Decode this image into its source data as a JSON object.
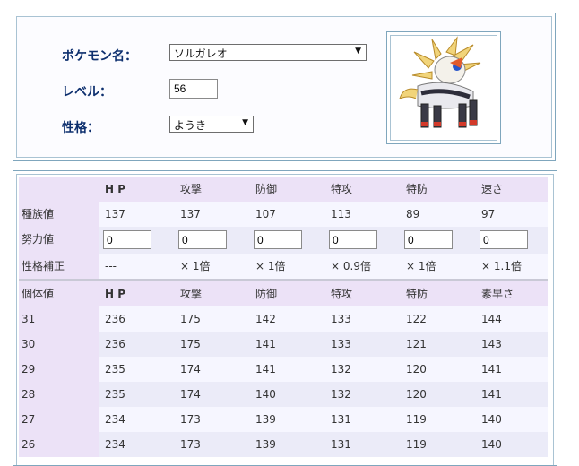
{
  "form": {
    "pokemon_label": "ポケモン名：",
    "pokemon_value": "ソルガレオ",
    "level_label": "レベル：",
    "level_value": "56",
    "nature_label": "性格：",
    "nature_value": "ようき"
  },
  "stats_table": {
    "headers": [
      "",
      "H P",
      "攻撃",
      "防御",
      "特攻",
      "特防",
      "速さ"
    ],
    "base": {
      "label": "種族値",
      "values": [
        "137",
        "137",
        "107",
        "113",
        "89",
        "97"
      ]
    },
    "ev": {
      "label": "努力値",
      "values": [
        "0",
        "0",
        "0",
        "0",
        "0",
        "0"
      ]
    },
    "nature_mod": {
      "label": "性格補正",
      "values": [
        "---",
        "× 1倍",
        "× 1倍",
        "× 0.9倍",
        "× 1倍",
        "× 1.1倍"
      ]
    }
  },
  "iv_table": {
    "headers": [
      "個体値",
      "H P",
      "攻撃",
      "防御",
      "特攻",
      "特防",
      "素早さ"
    ],
    "rows": [
      [
        "31",
        "236",
        "175",
        "142",
        "133",
        "122",
        "144"
      ],
      [
        "30",
        "236",
        "175",
        "141",
        "133",
        "121",
        "143"
      ],
      [
        "29",
        "235",
        "174",
        "141",
        "132",
        "120",
        "141"
      ],
      [
        "28",
        "235",
        "174",
        "140",
        "132",
        "120",
        "141"
      ],
      [
        "27",
        "234",
        "173",
        "139",
        "131",
        "119",
        "140"
      ],
      [
        "26",
        "234",
        "173",
        "139",
        "131",
        "119",
        "140"
      ]
    ]
  },
  "colors": {
    "header_bg": "#ece2f7",
    "label_blue": "#0d2f6e",
    "border": "#7fa6bd"
  }
}
